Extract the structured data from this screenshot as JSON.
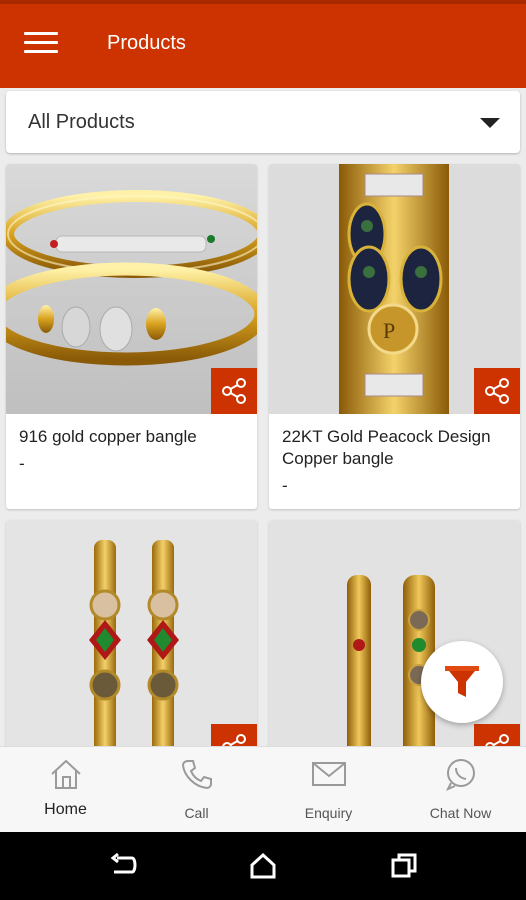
{
  "appbar": {
    "title": "Products",
    "menu_icon": "hamburger-menu-icon",
    "color": "#cc3300"
  },
  "filter": {
    "selected": "All Products"
  },
  "products": [
    {
      "name": "916 gold copper bangle",
      "price": "-"
    },
    {
      "name": "22KT Gold Peacock Design Copper bangle",
      "price": "-"
    },
    {
      "name": "",
      "price": ""
    },
    {
      "name": "",
      "price": ""
    }
  ],
  "fab": {
    "icon": "filter-funnel-icon"
  },
  "bottom_nav": {
    "home": "Home",
    "call": "Call",
    "enquiry": "Enquiry",
    "chat": "Chat Now"
  },
  "system_nav": {
    "back": "back-icon",
    "home": "home-circle-icon",
    "recents": "recents-icon"
  }
}
